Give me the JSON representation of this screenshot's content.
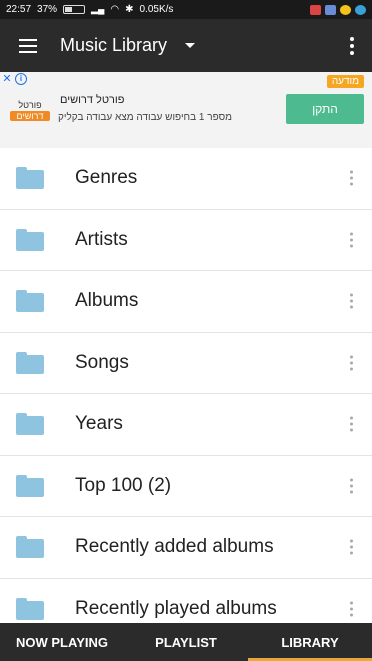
{
  "status_bar": {
    "time": "22:57",
    "battery": "37%",
    "battery_level": 0.37,
    "network_speed": "0.05K/s"
  },
  "app_bar": {
    "title": "Music Library"
  },
  "ad": {
    "badge": "מודעה",
    "headline": "פורטל דרושים",
    "body": "מספר 1 בחיפוש עבודה מצא עבודה בקליק",
    "button": "התקן",
    "logo_top": "פורטל",
    "logo_bottom": "דרושים"
  },
  "library": {
    "items": [
      {
        "label": "Genres"
      },
      {
        "label": "Artists"
      },
      {
        "label": "Albums"
      },
      {
        "label": "Songs"
      },
      {
        "label": "Years"
      },
      {
        "label": "Top 100 (2)"
      },
      {
        "label": "Recently added albums"
      },
      {
        "label": "Recently played albums"
      }
    ]
  },
  "tabs": [
    {
      "label": "NOW PLAYING"
    },
    {
      "label": "PLAYLIST"
    },
    {
      "label": "LIBRARY"
    }
  ],
  "colors": {
    "app_bar": "#2b2b2b",
    "folder": "#8fc4e0",
    "active_tab_indicator": "#e8a93a",
    "ad_button": "#4dbb8f"
  }
}
